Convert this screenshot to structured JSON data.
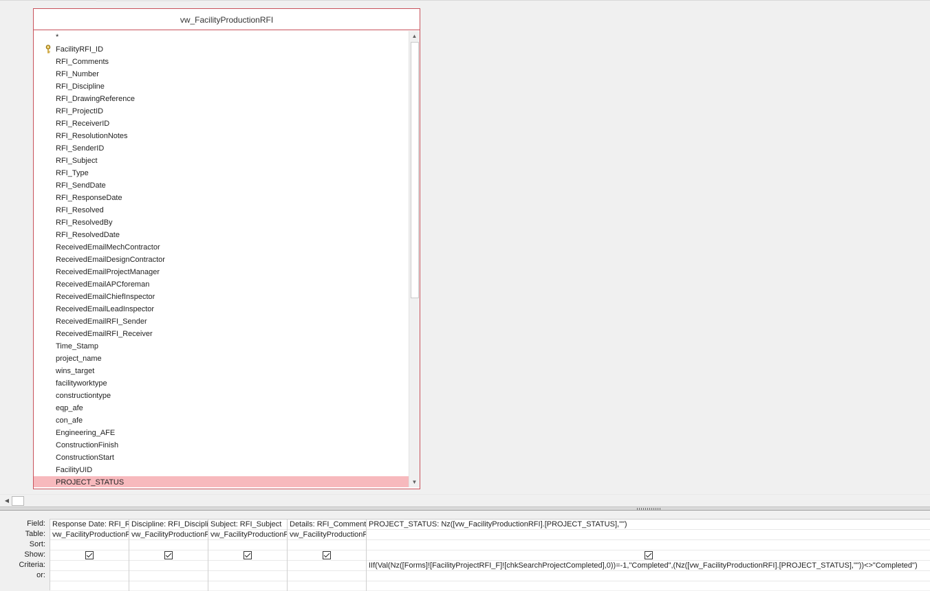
{
  "field_list": {
    "table_name": "vw_FacilityProductionRFI",
    "key_field": "FacilityRFI_ID",
    "fields": [
      "*",
      "FacilityRFI_ID",
      "RFI_Comments",
      "RFI_Number",
      "RFI_Discipline",
      "RFI_DrawingReference",
      "RFI_ProjectID",
      "RFI_ReceiverID",
      "RFI_ResolutionNotes",
      "RFI_SenderID",
      "RFI_Subject",
      "RFI_Type",
      "RFI_SendDate",
      "RFI_ResponseDate",
      "RFI_Resolved",
      "RFI_ResolvedBy",
      "RFI_ResolvedDate",
      "ReceivedEmailMechContractor",
      "ReceivedEmailDesignContractor",
      "ReceivedEmailProjectManager",
      "ReceivedEmailAPCforeman",
      "ReceivedEmailChiefInspector",
      "ReceivedEmailLeadInspector",
      "ReceivedEmailRFI_Sender",
      "ReceivedEmailRFI_Receiver",
      "Time_Stamp",
      "project_name",
      "wins_target",
      "facilityworktype",
      "constructiontype",
      "eqp_afe",
      "con_afe",
      "Engineering_AFE",
      "ConstructionFinish",
      "ConstructionStart",
      "FacilityUID",
      "PROJECT_STATUS"
    ],
    "selected_field": "PROJECT_STATUS",
    "selected_color": "#f7b9bd"
  },
  "icons": {
    "key": "primary-key-icon",
    "scroll_up": "arrow-up-icon",
    "scroll_down": "arrow-down-icon",
    "scroll_left": "arrow-left-icon"
  },
  "design_grid": {
    "row_labels": {
      "field": "Field:",
      "table": "Table:",
      "sort": "Sort:",
      "show": "Show:",
      "criteria": "Criteria:",
      "or": "or:"
    },
    "columns": [
      {
        "field": "Response Date: RFI_ResponseDate",
        "table": "vw_FacilityProductionRFI",
        "sort": "",
        "show": true,
        "criteria": "",
        "or": ""
      },
      {
        "field": "Discipline: RFI_Discipline",
        "table": "vw_FacilityProductionRFI",
        "sort": "",
        "show": true,
        "criteria": "",
        "or": ""
      },
      {
        "field": "Subject: RFI_Subject",
        "table": "vw_FacilityProductionRFI",
        "sort": "",
        "show": true,
        "criteria": "",
        "or": ""
      },
      {
        "field": "Details: RFI_Comments",
        "table": "vw_FacilityProductionRFI",
        "sort": "",
        "show": true,
        "criteria": "",
        "or": ""
      },
      {
        "field": "PROJECT_STATUS: Nz([vw_FacilityProductionRFI].[PROJECT_STATUS],\"\")",
        "table": "",
        "sort": "",
        "show": true,
        "criteria": "IIf(Val(Nz([Forms]![FacilityProjectRFI_F]![chkSearchProjectCompleted],0))=-1,\"Completed\",(Nz([vw_FacilityProductionRFI].[PROJECT_STATUS],\"\"))<>\"Completed\")",
        "or": ""
      }
    ]
  }
}
